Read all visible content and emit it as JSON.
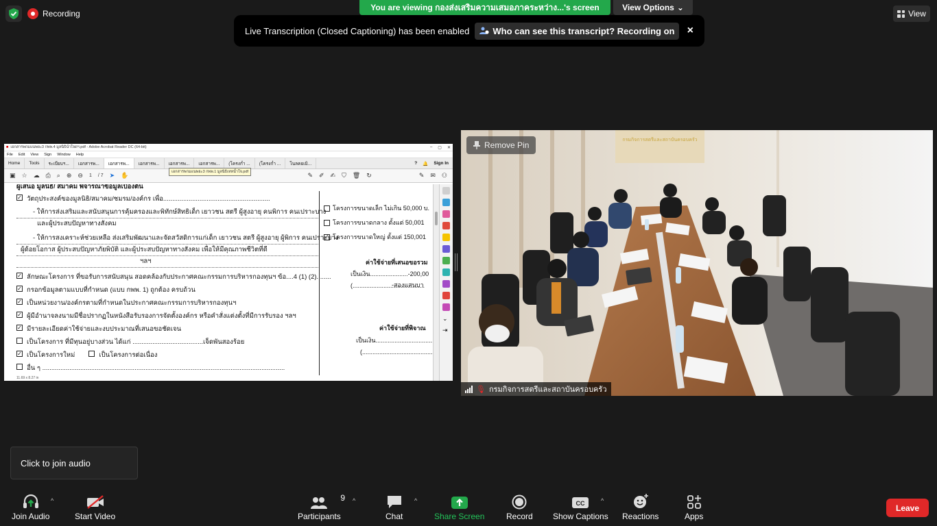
{
  "top": {
    "recording_label": "Recording",
    "viewing_banner": "You are viewing กองส่งเสริมความเสมอภาคระหว่าง...'s screen",
    "view_options_label": "View Options",
    "view_label": "View"
  },
  "toast": {
    "message": "Live Transcription (Closed Captioning) has been enabled",
    "who_label": "Who can see this transcript? Recording on",
    "close_glyph": "×"
  },
  "share": {
    "title": "เอกสารพกมแนพยะ3 กพพ.4 มูลนิธิน่ำใจดฯ.pdf - Adobe Acrobat Reader DC (64-bit)",
    "menu": [
      "File",
      "Edit",
      "View",
      "Sign",
      "Window",
      "Help"
    ],
    "tabs": [
      "Home",
      "Tools",
      "ระเบียบฯ...",
      "เอกสารพ...",
      "เอกสารพ...",
      "เอกสารพ...",
      "เอกสารพ...",
      "เอกสารพ...",
      "(โครงก่ำ ...",
      "(โครงก่ำ ...",
      "โนลคยเมิ..."
    ],
    "sign_in": "Sign In",
    "page_current": "1",
    "page_total": "/ 7",
    "tooltip": "เอกสารพกมแนพยะ3 กพพ.1 มูลนิธิเหหน้ำใจ.pdf",
    "doc_heading": "ผู้เสนอ มูลนิธิ/ สมาคม พิจารณาข้อมูลเบื้องต้น",
    "items": [
      {
        "checked": true,
        "text": "วัตถุประสงค์ของมูลนิธิ/สมาคม/ชมรม/องค์กร เพื่อ..........................................................."
      },
      {
        "checked": null,
        "text": "- ให้การส่งเสริมและสนับสนุนการคุ้มครองและพิทักษ์สิทธิเด็ก เยาวชน สตรี ผู้สูงอายุ  คนพิการ คนเปราะบาง"
      },
      {
        "checked": null,
        "text": "และผู้ประสบปัญหาทางสังคม"
      },
      {
        "checked": null,
        "text": "- ให้การสงเคราะห์ช่วยเหลือ ส่งเสริมพัฒนาและจัดสวัสดิการแก่เด็ก เยาวชน สตรี ผู้สูงอายุ ผู้พิการ คนเปราะบาง"
      },
      {
        "checked": null,
        "text": "ผู้ด้อยโอกาส ผู้ประสบปัญหาภัยพิบัติ และผู้ประสบปัญหาทางสังคม เพื่อให้มีคุณภาพชีวิตที่ดี"
      },
      {
        "checked": null,
        "text": "ฯลฯ"
      },
      {
        "checked": true,
        "text": "ลักษณะโครงการ ที่ขอรับการสนับสนุน สอดคล้องกับประกาศคณะกรรมการบริหารกองทุนฯ ข้อ....4 (1) (2)........"
      },
      {
        "checked": true,
        "text": "กรอกข้อมูลตามแบบที่กำหนด (แบบ กพพ. 1) ถูกต้อง ครบถ้วน"
      },
      {
        "checked": true,
        "text": "เป็นหน่วยงาน/องค์กรตามที่กำหนดในประกาศคณะกรรมการบริหารกองทุนฯ"
      },
      {
        "checked": true,
        "text": "ผู้มีอำนาจลงนามมีชื่อปรากฏในหนังสือรับรองการจัดตั้งองค์กร หรือคำสั่งแต่งตั้งที่มีการรับรอง ฯลฯ"
      },
      {
        "checked": true,
        "text": "มีรายละเอียดค่าใช้จ่ายและงบประมาณที่เสนอขอชัดเจน"
      },
      {
        "checked": false,
        "text": "เป็นโครงการ ที่มีทุนอยู่บางส่วน ได้แก่ .......................................เจ็ดพันสองร้อย"
      },
      {
        "checked": true,
        "text": "เป็นโครงการใหม่",
        "extra": "เป็นโครงการต่อเนื่อง"
      },
      {
        "checked": false,
        "text": "อื่น ๆ ......................................................................................................................................"
      }
    ],
    "right_items": [
      {
        "checked": false,
        "text": "โครงการขนาดเล็ก ไม่เกิน 50,000 บ."
      },
      {
        "checked": false,
        "text": "โครงการขนาดกลาง ตั้งแต่ 50,001"
      },
      {
        "checked": true,
        "text": "โครงการขนาดใหญ่ ตั้งแต่ 150,001"
      }
    ],
    "cost_request_label": "ค่าใช้จ่ายที่เสนอขอรวม",
    "cost_amount_label": "เป็นเงิน......................-200,00",
    "cost_words": "-สองแสนบา",
    "cost_paren": "(..........................................",
    "cost_consider_label": "ค่าใช้จ่ายที่พิจาณ",
    "cost_consider_amount": "เป็นเงิน.....................................",
    "cost_consider_paren": "(..........................................",
    "status_size": "11.69 x 8.27 in"
  },
  "video": {
    "remove_pin_label": "Remove Pin",
    "participant_name": "กรมกิจการสตรีและสถาบันครอบครัว",
    "banner_text": "กรมกิจการสตรีและสถาบันครอบครัว"
  },
  "audio_popup": "Click to join audio",
  "toolbar": {
    "join_audio": "Join Audio",
    "start_video": "Start Video",
    "participants": "Participants",
    "participants_count": "9",
    "chat": "Chat",
    "share_screen": "Share Screen",
    "record": "Record",
    "show_captions": "Show Captions",
    "reactions": "Reactions",
    "apps": "Apps",
    "leave": "Leave"
  },
  "colors": {
    "share_green": "#23a84b",
    "leave_red": "#e02828",
    "background": "#1a1a1a"
  }
}
